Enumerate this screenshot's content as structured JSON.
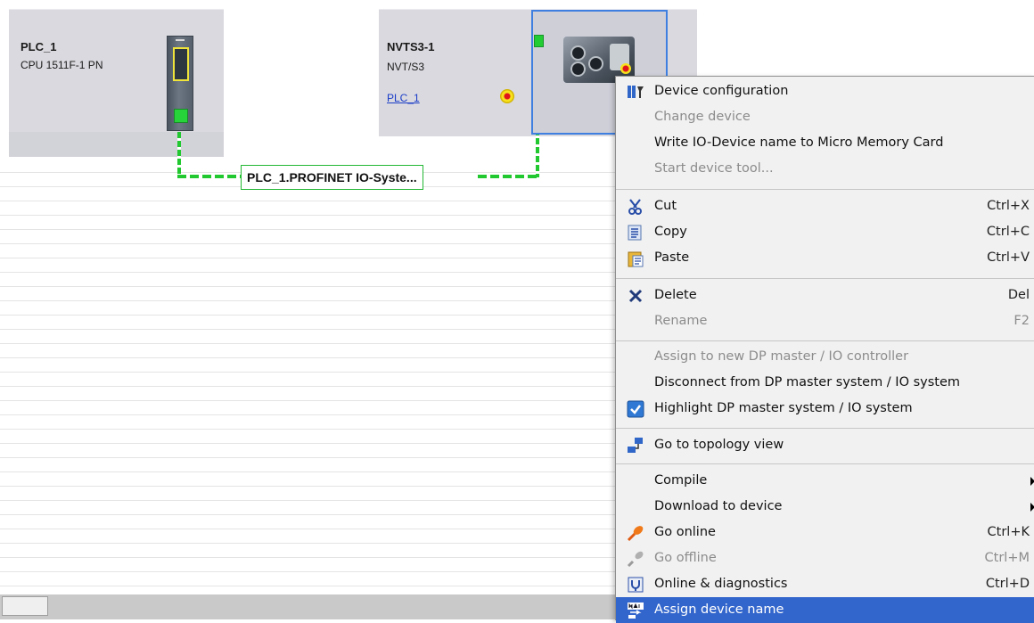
{
  "devices": {
    "plc": {
      "name": "PLC_1",
      "type": "CPU 1511F-1 PN"
    },
    "io_device": {
      "name": "NVTS3-1",
      "type": "NVT/S3",
      "controller_link": "PLC_1"
    }
  },
  "network": {
    "label": "PLC_1.PROFINET IO-Syste..."
  },
  "context_menu": {
    "items": [
      {
        "label": "Device configuration",
        "icon": "device-config-icon",
        "shortcut": "",
        "enabled": true
      },
      {
        "label": "Change device",
        "shortcut": "",
        "enabled": false
      },
      {
        "label": "Write IO-Device name to Micro Memory Card",
        "shortcut": "",
        "enabled": true
      },
      {
        "label": "Start device tool...",
        "shortcut": "",
        "enabled": false
      },
      {
        "label": "Cut",
        "icon": "scissors-icon",
        "shortcut": "Ctrl+X",
        "enabled": true
      },
      {
        "label": "Copy",
        "icon": "copy-icon",
        "shortcut": "Ctrl+C",
        "enabled": true
      },
      {
        "label": "Paste",
        "icon": "paste-icon",
        "shortcut": "Ctrl+V",
        "enabled": true
      },
      {
        "label": "Delete",
        "icon": "delete-x-icon",
        "shortcut": "Del",
        "enabled": true
      },
      {
        "label": "Rename",
        "shortcut": "F2",
        "enabled": false
      },
      {
        "label": "Assign to new DP master / IO controller",
        "shortcut": "",
        "enabled": false
      },
      {
        "label": "Disconnect from DP master system / IO system",
        "shortcut": "",
        "enabled": true
      },
      {
        "label": "Highlight DP master system / IO system",
        "icon": "checkbox-checked-icon",
        "shortcut": "",
        "enabled": true
      },
      {
        "label": "Go to topology view",
        "icon": "topology-icon",
        "shortcut": "",
        "enabled": true
      },
      {
        "label": "Compile",
        "shortcut": "",
        "enabled": true,
        "submenu": true
      },
      {
        "label": "Download to device",
        "shortcut": "",
        "enabled": true,
        "submenu": true
      },
      {
        "label": "Go online",
        "icon": "go-online-icon",
        "shortcut": "Ctrl+K",
        "enabled": true
      },
      {
        "label": "Go offline",
        "icon": "go-offline-icon",
        "shortcut": "Ctrl+M",
        "enabled": false
      },
      {
        "label": "Online & diagnostics",
        "icon": "diagnostics-icon",
        "shortcut": "Ctrl+D",
        "enabled": true
      },
      {
        "label": "Assign device name",
        "icon": "name-assign-icon",
        "shortcut": "",
        "enabled": true,
        "highlighted": true
      }
    ]
  },
  "colors": {
    "menu_highlight": "#3366cc",
    "network_green": "#22c82f",
    "selection_blue": "#3f7fe0"
  }
}
